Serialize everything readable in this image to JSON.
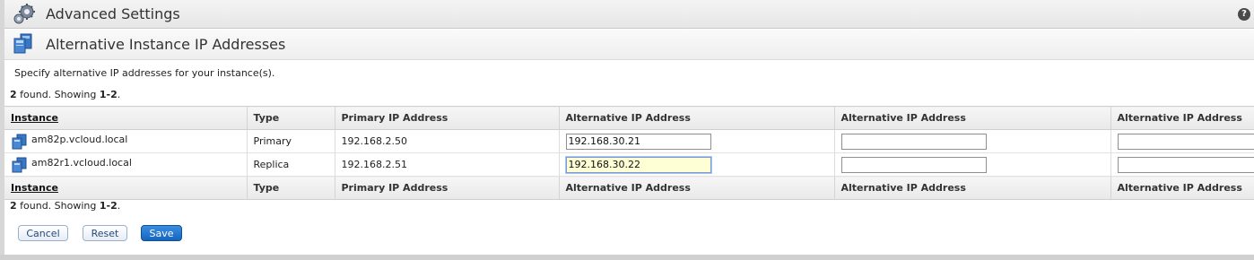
{
  "header": {
    "title": "Advanced Settings",
    "help_label": "?"
  },
  "section": {
    "title": "Alternative Instance IP Addresses"
  },
  "description": "Specify alternative IP addresses for your instance(s).",
  "paging": {
    "count": "2",
    "found_text": " found. Showing ",
    "range": "1-2",
    "suffix": "."
  },
  "table": {
    "columns": [
      "Instance",
      "Type",
      "Primary IP Address",
      "Alternative IP Address",
      "Alternative IP Address",
      "Alternative IP Address"
    ],
    "rows": [
      {
        "instance": "am82p.vcloud.local",
        "type": "Primary",
        "primary_ip": "192.168.2.50",
        "alt_ip_1": "192.168.30.21",
        "alt_ip_2": "",
        "alt_ip_3": ""
      },
      {
        "instance": "am82r1.vcloud.local",
        "type": "Replica",
        "primary_ip": "192.168.2.51",
        "alt_ip_1": "192.168.30.22",
        "alt_ip_2": "",
        "alt_ip_3": ""
      }
    ]
  },
  "buttons": {
    "cancel": "Cancel",
    "reset": "Reset",
    "save": "Save"
  },
  "icons": {
    "header": "gears-icon",
    "section": "instances-icon",
    "row": "vm-icon",
    "help": "help-icon"
  },
  "colors": {
    "primary_button": "#1565c0",
    "active_input": "#ffffd6"
  }
}
